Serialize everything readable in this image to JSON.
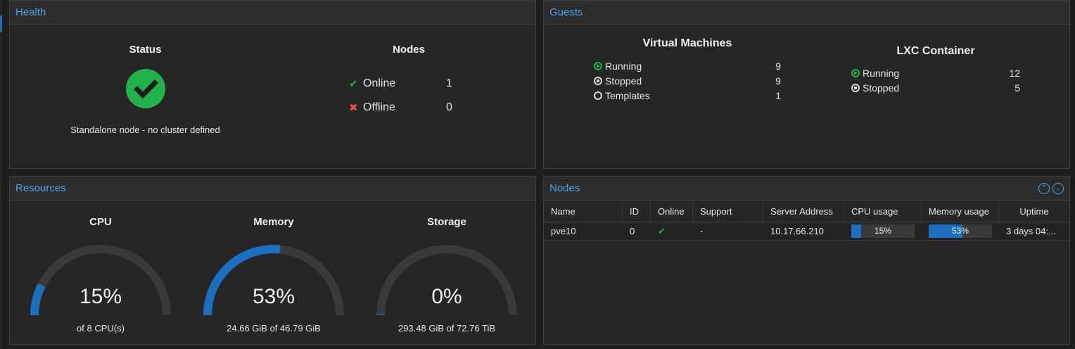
{
  "health": {
    "title": "Health",
    "status_heading": "Status",
    "status_text": "Standalone node - no cluster defined",
    "nodes_heading": "Nodes",
    "online_label": "Online",
    "online_count": "1",
    "offline_label": "Offline",
    "offline_count": "0",
    "status_color": "#21b24b"
  },
  "guests": {
    "title": "Guests",
    "vm_heading": "Virtual Machines",
    "vm": [
      {
        "label": "Running",
        "value": "9",
        "icon": "running-icon"
      },
      {
        "label": "Stopped",
        "value": "9",
        "icon": "stopped-icon"
      },
      {
        "label": "Templates",
        "value": "1",
        "icon": "template-icon"
      }
    ],
    "lxc_heading": "LXC Container",
    "lxc": [
      {
        "label": "Running",
        "value": "12",
        "icon": "running-icon"
      },
      {
        "label": "Stopped",
        "value": "5",
        "icon": "stopped-icon"
      }
    ]
  },
  "resources": {
    "title": "Resources",
    "cpu": {
      "heading": "CPU",
      "percent_text": "15%",
      "fraction": 0.15,
      "sub": "of 8 CPU(s)"
    },
    "memory": {
      "heading": "Memory",
      "percent_text": "53%",
      "fraction": 0.53,
      "sub": "24.66 GiB of 46.79 GiB"
    },
    "storage": {
      "heading": "Storage",
      "percent_text": "0%",
      "fraction": 0.004,
      "sub": "293.48 GiB of 72.76 TiB"
    },
    "accent": "#1c6fbf"
  },
  "nodes": {
    "title": "Nodes",
    "columns": [
      "Name",
      "ID",
      "Online",
      "Support",
      "Server Address",
      "CPU usage",
      "Memory usage",
      "Uptime"
    ],
    "rows": [
      {
        "name": "pve10",
        "id": "0",
        "support": "-",
        "address": "10.17.66.210",
        "cpu_text": "15%",
        "cpu_fraction": 0.15,
        "mem_text": "53%",
        "mem_fraction": 0.53,
        "uptime": "3 days 04:..."
      }
    ]
  }
}
